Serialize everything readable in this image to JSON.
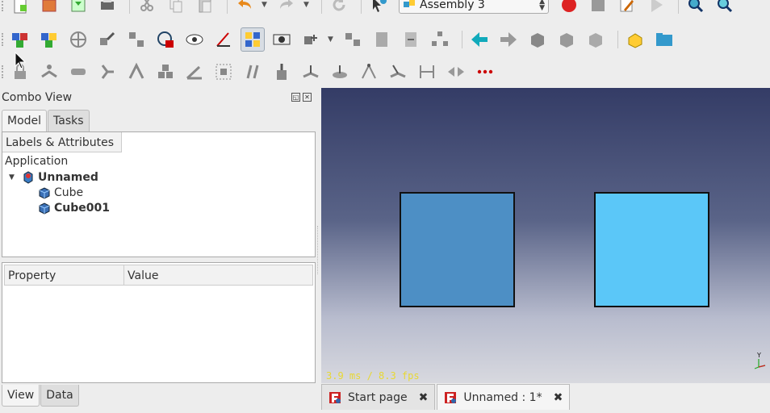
{
  "toolbar": {
    "workbench_selector": "Assembly 3"
  },
  "combo_view": {
    "title": "Combo View",
    "tabs": [
      "Model",
      "Tasks"
    ],
    "tree": {
      "header": "Labels & Attributes",
      "application_label": "Application",
      "document": "Unnamed",
      "items": [
        "Cube",
        "Cube001"
      ]
    },
    "property": {
      "columns": [
        "Property",
        "Value"
      ]
    },
    "bottom_tabs": [
      "View",
      "Data"
    ]
  },
  "view3d": {
    "fps_text": "3.9 ms / 8.3 fps",
    "axis_label": "Y"
  },
  "document_tabs": [
    {
      "label": "Start page"
    },
    {
      "label": "Unnamed : 1*"
    }
  ],
  "colors": {
    "cube_dark": "#4d8fc5",
    "cube_light": "#5bc7f8",
    "fps_text": "#e8d832",
    "bg_top": "#343c66"
  }
}
